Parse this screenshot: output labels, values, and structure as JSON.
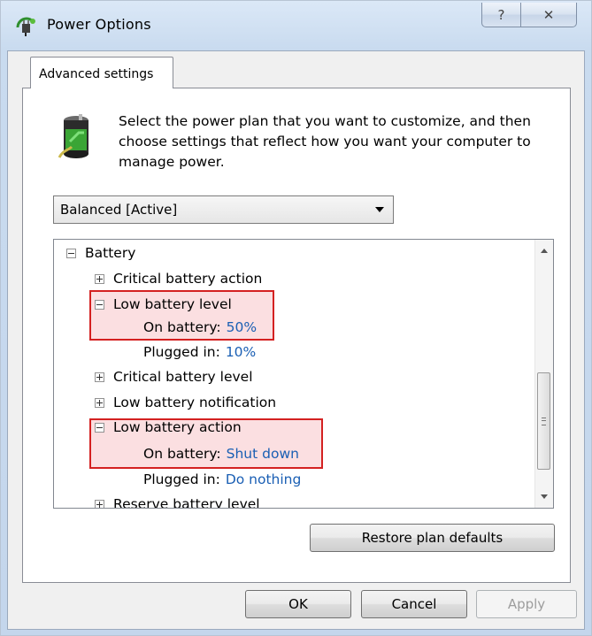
{
  "window": {
    "title": "Power Options",
    "help_glyph": "?",
    "close_glyph": "✕"
  },
  "tab": {
    "label": "Advanced settings"
  },
  "intro_text": "Select the power plan that you want to customize, and then choose settings that reflect how you want your computer to manage power.",
  "plan_select": {
    "value": "Balanced [Active]"
  },
  "tree": {
    "rows": [
      {
        "label": "Battery",
        "expander": "minus"
      },
      {
        "label": "Critical battery action",
        "expander": "plus"
      },
      {
        "label": "Low battery level",
        "expander": "minus"
      },
      {
        "label": "On battery:",
        "value": "50%"
      },
      {
        "label": "Plugged in:",
        "value": "10%"
      },
      {
        "label": "Critical battery level",
        "expander": "plus"
      },
      {
        "label": "Low battery notification",
        "expander": "plus"
      },
      {
        "label": "Low battery action",
        "expander": "minus"
      },
      {
        "label": "On battery:",
        "value": "Shut down"
      },
      {
        "label": "Plugged in:",
        "value": "Do nothing"
      },
      {
        "label": "Reserve battery level",
        "expander": "plus"
      }
    ]
  },
  "buttons": {
    "restore": "Restore plan defaults",
    "ok": "OK",
    "cancel": "Cancel",
    "apply": "Apply"
  },
  "colors": {
    "value_link": "#1a5fb4",
    "highlight_border": "#d42121",
    "highlight_fill": "#f7c4c8"
  }
}
